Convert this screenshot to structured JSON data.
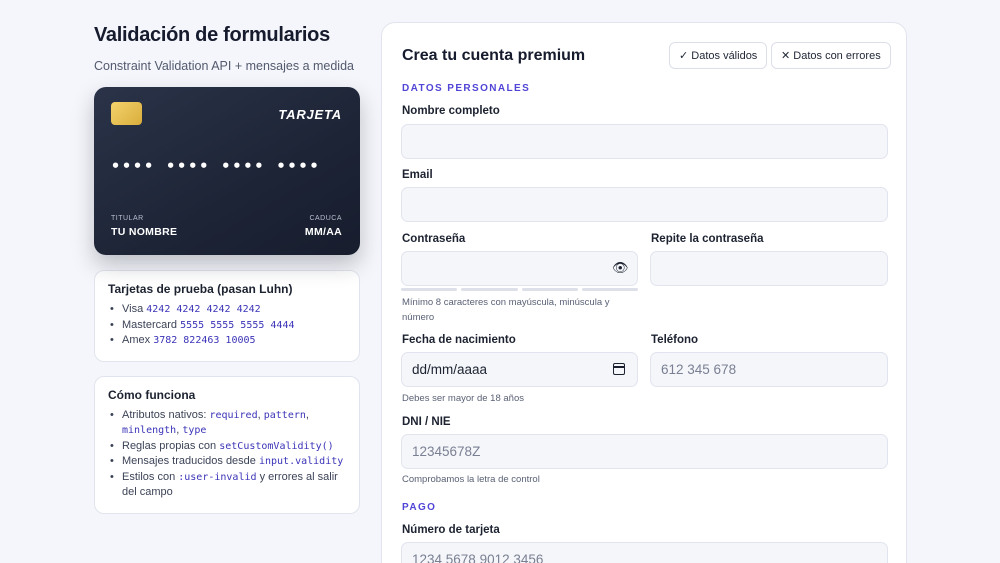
{
  "header": {
    "title": "Validación de formularios",
    "subtitle": "Constraint Validation API + mensajes a medida"
  },
  "card": {
    "brand": "TARJETA",
    "number": "•••• •••• •••• ••••",
    "holder_label": "TITULAR",
    "holder": "TU NOMBRE",
    "exp_label": "CADUCA",
    "exp": "MM/AA"
  },
  "test_cards": {
    "title": "Tarjetas de prueba (pasan Luhn)",
    "items": [
      {
        "name": "Visa",
        "number": "4242 4242 4242 4242"
      },
      {
        "name": "Mastercard",
        "number": "5555 5555 5555 4444"
      },
      {
        "name": "Amex",
        "number": "3782 822463 10005"
      }
    ]
  },
  "how_it_works": {
    "title": "Cómo funciona",
    "items": [
      {
        "pre": "Atributos nativos: ",
        "code1": "required",
        "mid1": ", ",
        "code2": "pattern",
        "mid2": ", ",
        "code3": "minlength",
        "mid3": ", ",
        "code4": "type"
      },
      {
        "pre": "Reglas propias con ",
        "code1": "setCustomValidity()"
      },
      {
        "pre": "Mensajes traducidos desde ",
        "code1": "input.validity"
      },
      {
        "pre": "Estilos con ",
        "code1": ":user-invalid",
        "post": " y errores al salir del campo"
      }
    ]
  },
  "form": {
    "title": "Crea tu cuenta premium",
    "btn_valid": "✓ Datos válidos",
    "btn_errors": "✕ Datos con errores",
    "section_personal": "DATOS PERSONALES",
    "name_label": "Nombre completo",
    "email_label": "Email",
    "password_label": "Contraseña",
    "password_hint": "Mínimo 8 caracteres con mayúscula, minúscula y número",
    "repeat_label": "Repite la contraseña",
    "dob_label": "Fecha de nacimiento",
    "dob_placeholder": "dd/mm/aaaa",
    "dob_hint": "Debes ser mayor de 18 años",
    "phone_label": "Teléfono",
    "phone_placeholder": "612 345 678",
    "dni_label": "DNI / NIE",
    "dni_placeholder": "12345678Z",
    "dni_hint": "Comprobamos la letra de control",
    "section_payment": "PAGO",
    "card_label": "Número de tarjeta",
    "card_placeholder": "1234 5678 9012 3456"
  },
  "icons": {
    "eye": "eye-icon",
    "calendar": "calendar-icon"
  },
  "colors": {
    "accent": "#5145d6",
    "code": "#3b34b8",
    "card_bg": "#1d2436",
    "chip": "#e8c255"
  }
}
